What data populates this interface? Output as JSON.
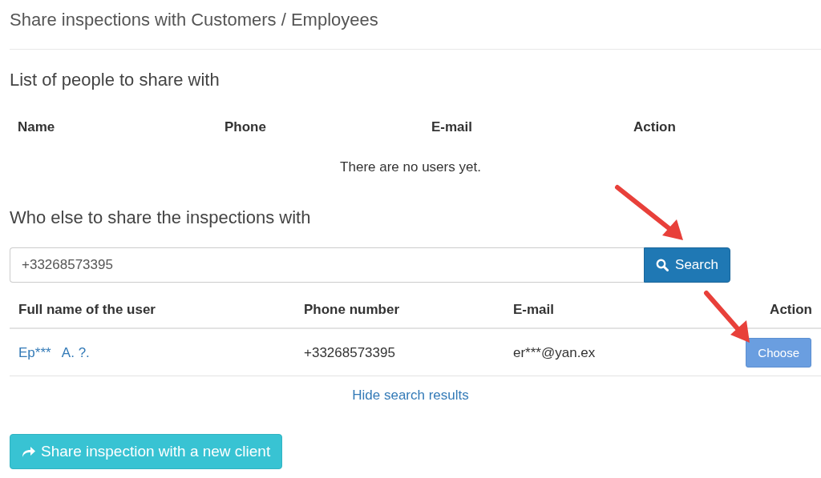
{
  "page_title": "Share inspections with Customers / Employees",
  "share_list": {
    "heading": "List of people to share with",
    "columns": [
      "Name",
      "Phone",
      "E-mail",
      "Action"
    ],
    "empty_message": "There are no users yet."
  },
  "search_section": {
    "heading": "Who else to share the inspections with",
    "search_value": "+33268573395",
    "search_button": "Search"
  },
  "results": {
    "columns": [
      "Full name of the user",
      "Phone number",
      "E-mail",
      "Action"
    ],
    "rows": [
      {
        "name": "Ep***   A. ?.",
        "phone": "+33268573395",
        "email": "er***@yan.ex",
        "action": "Choose"
      }
    ],
    "hide_link": "Hide search results"
  },
  "new_client_button": "Share inspection with a new client"
}
